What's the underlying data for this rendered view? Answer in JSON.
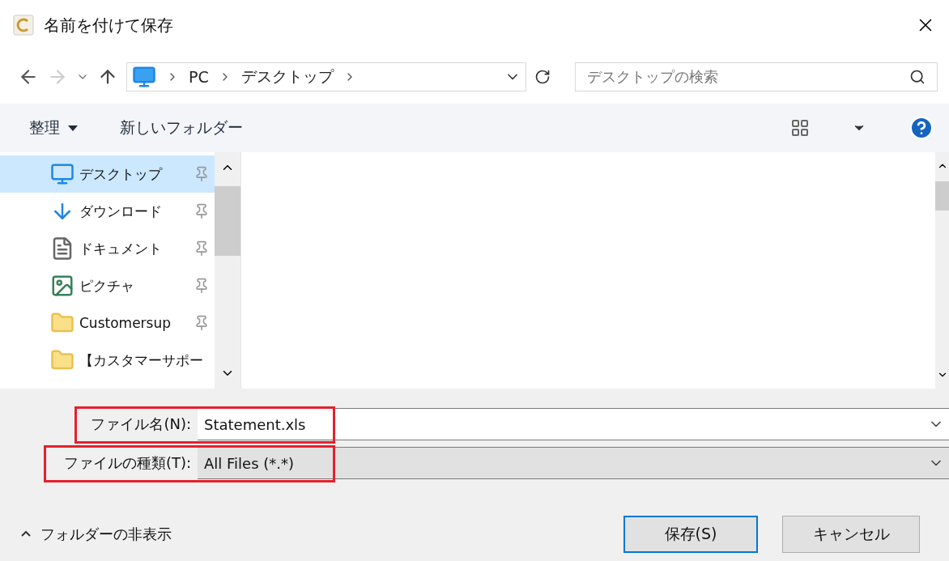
{
  "window": {
    "title": "名前を付けて保存"
  },
  "address": {
    "crumbs": [
      "PC",
      "デスクトップ"
    ]
  },
  "search": {
    "placeholder": "デスクトップの検索"
  },
  "toolbar": {
    "organize": "整理",
    "new_folder": "新しいフォルダー"
  },
  "sidebar": {
    "items": [
      {
        "label": "デスクトップ",
        "kind": "desktop",
        "selected": true,
        "pinned": true
      },
      {
        "label": "ダウンロード",
        "kind": "download",
        "selected": false,
        "pinned": true
      },
      {
        "label": "ドキュメント",
        "kind": "document",
        "selected": false,
        "pinned": true
      },
      {
        "label": "ピクチャ",
        "kind": "picture",
        "selected": false,
        "pinned": true
      },
      {
        "label": "Customersup",
        "kind": "folder",
        "selected": false,
        "pinned": true
      },
      {
        "label": "【カスタマーサポー",
        "kind": "folder",
        "selected": false,
        "pinned": false
      }
    ]
  },
  "fields": [
    {
      "label": "ファイル名(N):",
      "value": "Statement.xls",
      "kind": "input",
      "highlighted": true
    },
    {
      "label": "ファイルの種類(T):",
      "value": "All Files (*.*)",
      "kind": "select",
      "highlighted": true
    }
  ],
  "hide_folders": "フォルダーの非表示",
  "buttons": [
    {
      "label": "保存(S)",
      "default": true
    },
    {
      "label": "キャンセル",
      "default": false
    }
  ]
}
